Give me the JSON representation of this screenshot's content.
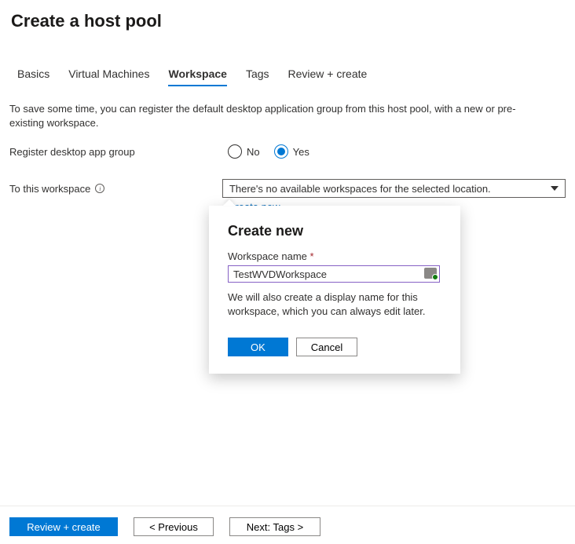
{
  "page": {
    "title": "Create a host pool"
  },
  "tabs": [
    {
      "label": "Basics",
      "active": false
    },
    {
      "label": "Virtual Machines",
      "active": false
    },
    {
      "label": "Workspace",
      "active": true
    },
    {
      "label": "Tags",
      "active": false
    },
    {
      "label": "Review + create",
      "active": false
    }
  ],
  "intro": "To save some time, you can register the default desktop application group from this host pool, with a new or pre-existing workspace.",
  "form": {
    "register_label": "Register desktop app group",
    "register_options": {
      "no": "No",
      "yes": "Yes",
      "selected": "yes"
    },
    "workspace_label": "To this workspace",
    "workspace_dropdown_text": "There's no available workspaces for the selected location.",
    "create_new_link": "Create new"
  },
  "callout": {
    "title": "Create new",
    "field_label": "Workspace name",
    "required_marker": "*",
    "value": "TestWVDWorkspace",
    "help_text": "We will also create a display name for this workspace, which you can always edit later.",
    "ok_label": "OK",
    "cancel_label": "Cancel"
  },
  "footer": {
    "review_label": "Review + create",
    "previous_label": "< Previous",
    "next_label": "Next: Tags >"
  }
}
